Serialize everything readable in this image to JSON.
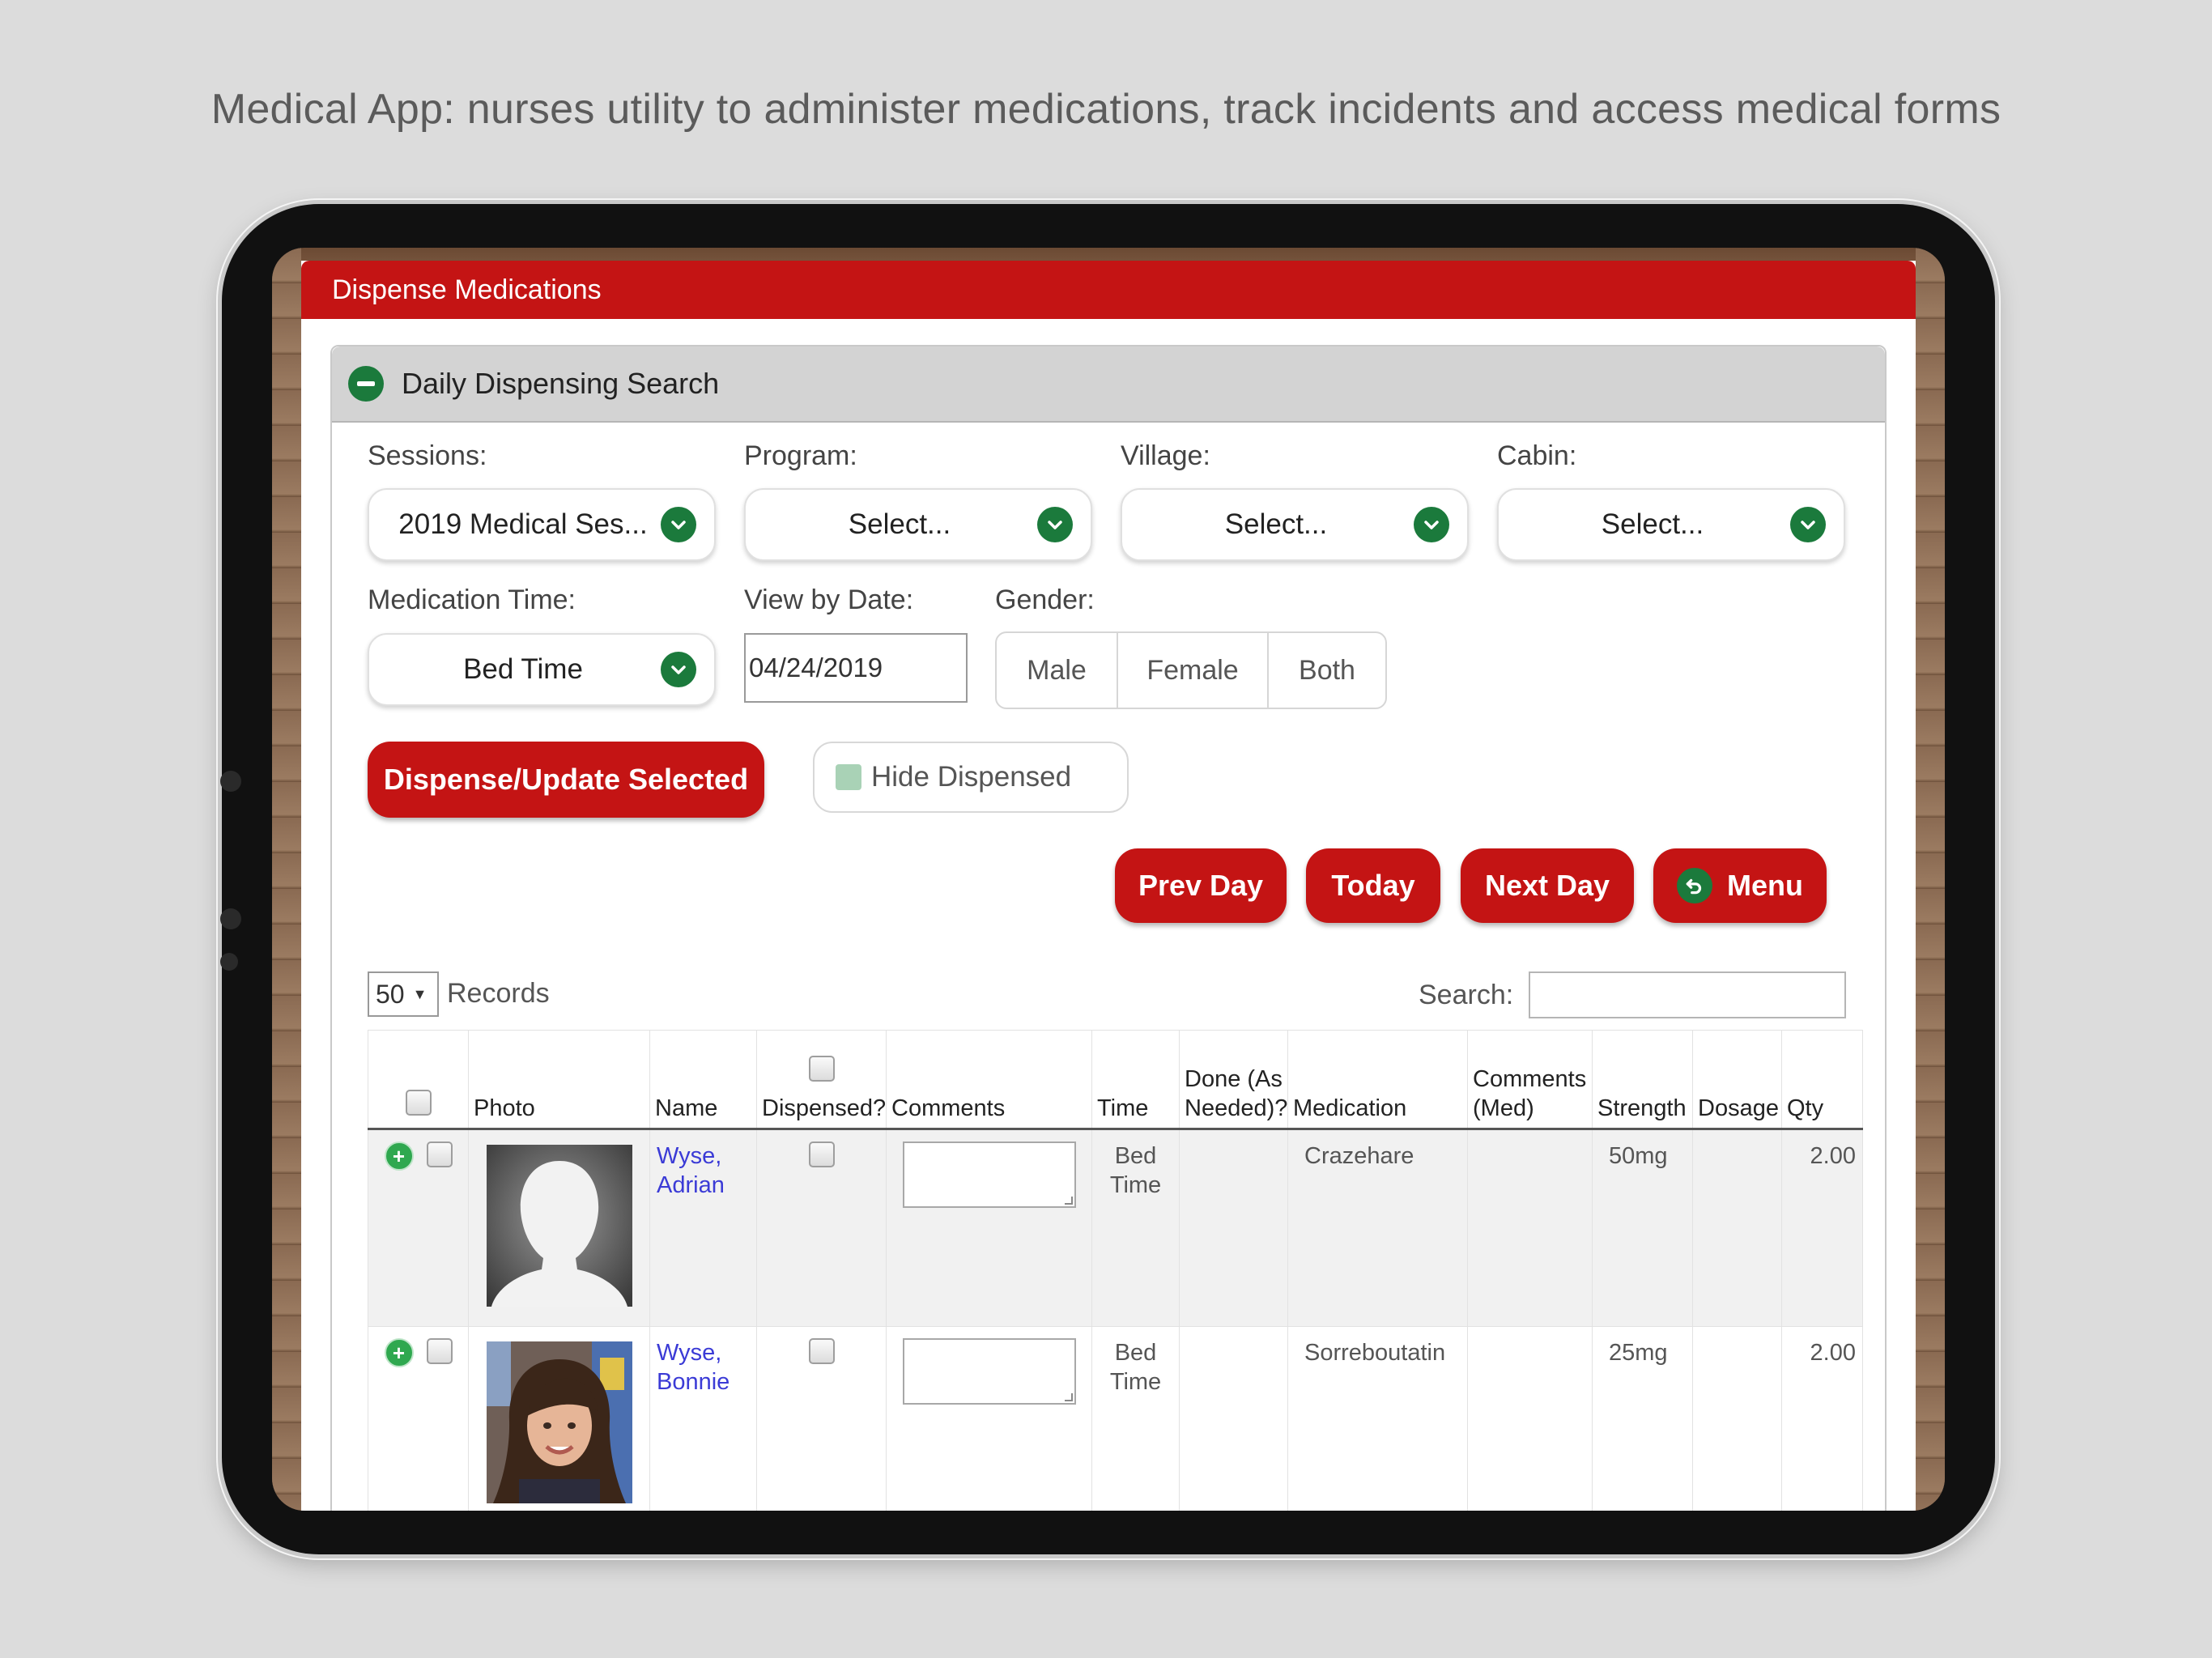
{
  "headline": "Medical App: nurses utility to administer medications, track incidents and access medical forms",
  "titlebar": {
    "title": "Dispense Medications"
  },
  "panel": {
    "title": "Daily Dispensing Search"
  },
  "filters": {
    "sessions": {
      "label": "Sessions:",
      "value": "2019 Medical Ses..."
    },
    "program": {
      "label": "Program:",
      "value": "Select..."
    },
    "village": {
      "label": "Village:",
      "value": "Select..."
    },
    "cabin": {
      "label": "Cabin:",
      "value": "Select..."
    },
    "medication_time": {
      "label": "Medication Time:",
      "value": "Bed Time"
    },
    "view_by_date": {
      "label": "View by Date:",
      "value": "04/24/2019"
    },
    "gender": {
      "label": "Gender:",
      "options": [
        "Male",
        "Female",
        "Both"
      ]
    }
  },
  "actions": {
    "dispense": "Dispense/Update Selected",
    "hide_dispensed": "Hide Dispensed",
    "prev_day": "Prev Day",
    "today": "Today",
    "next_day": "Next Day",
    "menu": "Menu"
  },
  "table_controls": {
    "records_count": "50",
    "records_label": "Records",
    "search_label": "Search:"
  },
  "columns": {
    "photo": "Photo",
    "name": "Name",
    "dispensed": "Dispensed?",
    "comments": "Comments",
    "time": "Time",
    "done": "Done (As Needed)?",
    "medication": "Medication",
    "comments_med": "Comments (Med)",
    "strength": "Strength",
    "dosage": "Dosage",
    "qty": "Qty"
  },
  "rows": [
    {
      "name": "Wyse, Adrian",
      "time": "Bed Time",
      "medication": "Crazehare",
      "strength": "50mg",
      "dosage": "",
      "qty": "2.00"
    },
    {
      "name": "Wyse, Bonnie",
      "time": "Bed Time",
      "medication": "Sorreboutatin",
      "strength": "25mg",
      "dosage": "",
      "qty": "2.00"
    }
  ],
  "colors": {
    "primary_red": "#c41414",
    "accent_green": "#1b7a3c"
  }
}
